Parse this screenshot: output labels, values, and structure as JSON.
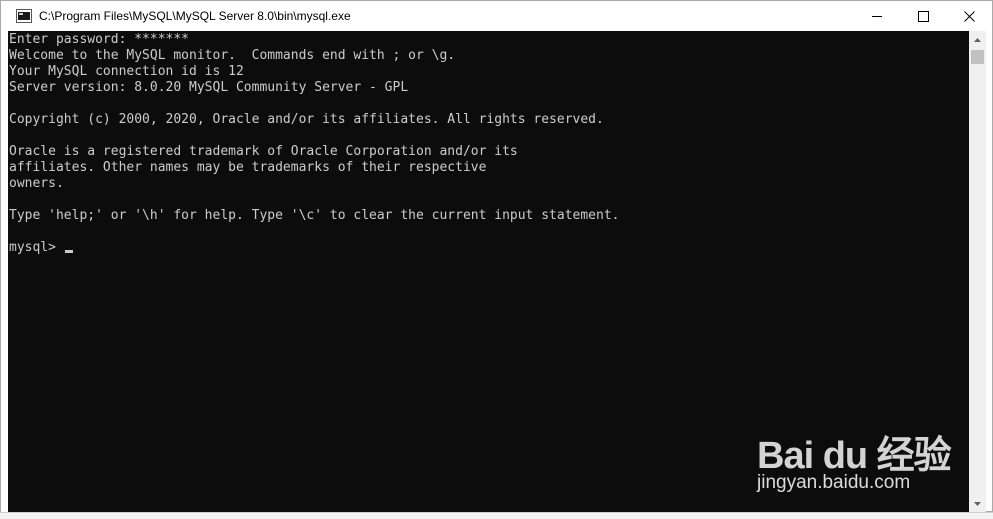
{
  "window": {
    "title": "C:\\Program Files\\MySQL\\MySQL Server 8.0\\bin\\mysql.exe",
    "minimize_label": "—",
    "maximize_label": "☐",
    "close_label": "✕"
  },
  "console": {
    "lines": [
      "Enter password: *******",
      "Welcome to the MySQL monitor.  Commands end with ; or \\g.",
      "Your MySQL connection id is 12",
      "Server version: 8.0.20 MySQL Community Server - GPL",
      "",
      "Copyright (c) 2000, 2020, Oracle and/or its affiliates. All rights reserved.",
      "",
      "Oracle is a registered trademark of Oracle Corporation and/or its",
      "affiliates. Other names may be trademarks of their respective",
      "owners.",
      "",
      "Type 'help;' or '\\h' for help. Type '\\c' to clear the current input statement.",
      ""
    ],
    "prompt": "mysql> "
  },
  "watermark": {
    "brand": "Bai du 经验",
    "url": "jingyan.baidu.com"
  },
  "colors": {
    "console_bg": "#0c0c0c",
    "console_fg": "#cccccc"
  }
}
